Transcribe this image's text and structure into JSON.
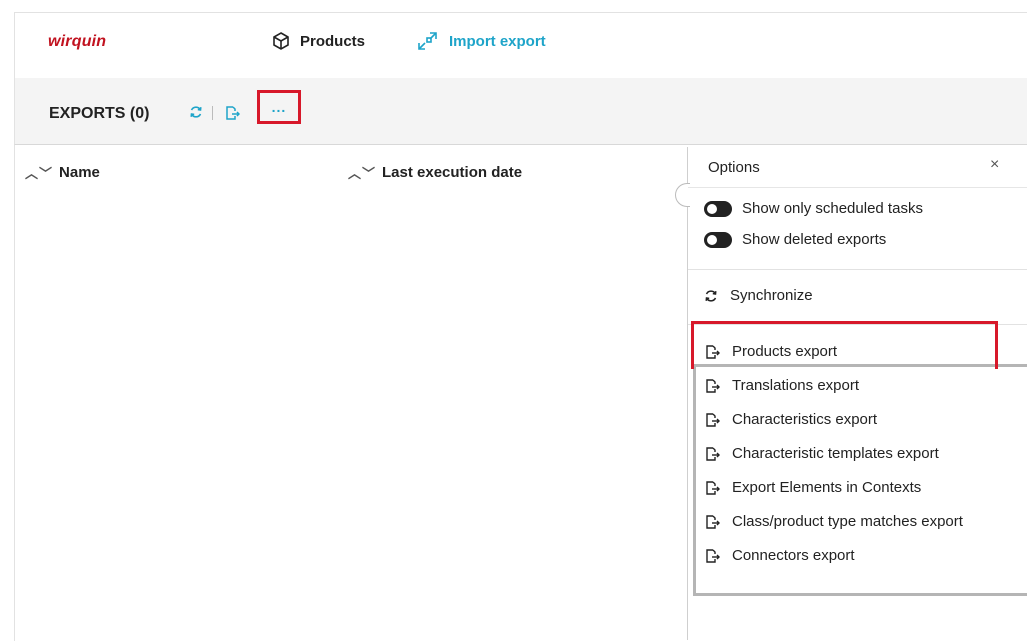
{
  "header": {
    "logo": "wirquin",
    "nav": [
      {
        "label": "Products",
        "icon": "cube-icon"
      },
      {
        "label": "Import export",
        "icon": "import-export-icon"
      }
    ]
  },
  "toolbar": {
    "title": "EXPORTS (0)",
    "more_label": "..."
  },
  "table": {
    "columns": [
      "Name",
      "Last execution date"
    ],
    "rows": []
  },
  "options_panel": {
    "title": "Options",
    "close": "×",
    "toggles": [
      {
        "label": "Show only scheduled tasks",
        "on": true
      },
      {
        "label": "Show deleted exports",
        "on": true
      }
    ],
    "synchronize": "Synchronize",
    "export_items": [
      "Products export",
      "Translations export",
      "Characteristics export",
      "Characteristic templates export",
      "Export Elements in Contexts",
      "Class/product type matches export",
      "Connectors export"
    ]
  },
  "colors": {
    "accent": "#1ea4c9",
    "brand": "#c1121f",
    "highlight": "#d7182a"
  }
}
